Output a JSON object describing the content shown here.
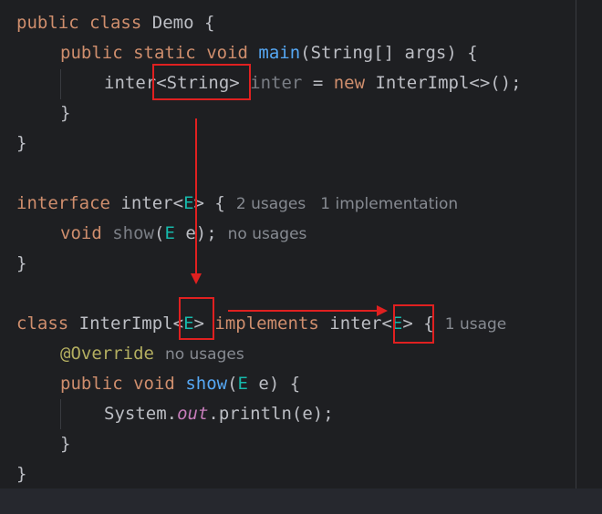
{
  "code": {
    "l1": {
      "kw1": "public",
      "kw2": "class",
      "name": "Demo {"
    },
    "l2": {
      "kw1": "public",
      "kw2": "static",
      "kw3": "void",
      "method": "main",
      "rest": "(String[] args) {"
    },
    "l3": {
      "type": "inter",
      "generic": "<String>",
      "var": "inter",
      "eq": " = ",
      "kw": "new",
      "rest": " InterImpl<>();"
    },
    "l4": {
      "text": "}"
    },
    "l5": {
      "text": "}"
    },
    "l7": {
      "kw": "interface",
      "name": "inter",
      "lt": "<",
      "param": "E",
      "gt": ">",
      "brace": " {",
      "hint1": "2 usages",
      "hint2": "1 implementation"
    },
    "l8": {
      "kw": "void",
      "method": "show",
      "open": "(",
      "param": "E",
      "rest": " e);",
      "hint": "no usages"
    },
    "l9": {
      "text": "}"
    },
    "l11": {
      "kw": "class",
      "name": "InterImpl",
      "lt": "<",
      "param": "E",
      "gt": ">",
      "kw2": "implements",
      "iface": "inter",
      "lt2": "<",
      "param2": "E",
      "gt2": ">",
      "brace": " {",
      "hint": "1 usage"
    },
    "l12": {
      "ann": "@Override",
      "hint": "no usages"
    },
    "l13": {
      "kw1": "public",
      "kw2": "void",
      "method": "show",
      "open": "(",
      "param": "E",
      "rest": " e) {"
    },
    "l14": {
      "cls": "System.",
      "field": "out",
      "rest": ".println(e);"
    },
    "l15": {
      "text": "}"
    },
    "l16": {
      "text": "}"
    }
  },
  "annotations": {
    "box_color": "#e02020",
    "arrow_color": "#e02020"
  }
}
